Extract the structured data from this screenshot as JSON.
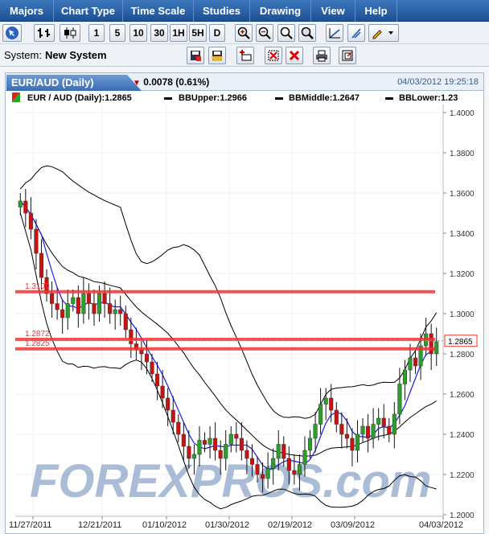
{
  "menu": [
    "Majors",
    "Chart Type",
    "Time Scale",
    "Studies",
    "Drawing",
    "View",
    "Help"
  ],
  "toolbar1": {
    "buttons": [
      "1",
      "5",
      "10",
      "30",
      "1H",
      "5H",
      "D"
    ]
  },
  "system": {
    "label": "System:",
    "value": "New System"
  },
  "chart_header": {
    "tab": "EUR/AUD (Daily)",
    "change": "0.0078 (0.61%)",
    "datetime": "04/03/2012 19:25:18"
  },
  "legend": {
    "main": "EUR / AUD (Daily):1.2865",
    "bbupper": "BBUpper:1.2966",
    "bbmiddle": "BBMiddle:1.2647",
    "bblower": "BBLower:1.23"
  },
  "watermark": "FOREXPROS.com",
  "colors": {
    "up": "#2aa02a",
    "down": "#cc1111",
    "hline": "#ee3333",
    "ma": "#1a1aee",
    "bb": "#000000",
    "menu": "#2a5ea8"
  },
  "chart_data": {
    "type": "candlestick",
    "symbol": "EUR/AUD",
    "current_price": "1.2865",
    "y_ticks": [
      "1.4000",
      "1.3800",
      "1.3600",
      "1.3400",
      "1.3200",
      "1.3000",
      "1.2800",
      "1.2600",
      "1.2400",
      "1.2200",
      "1.2000"
    ],
    "ylim": [
      1.2,
      1.4
    ],
    "x_ticks": [
      "11/27/2011",
      "12/21/2011",
      "01/10/2012",
      "01/30/2012",
      "02/19/2012",
      "03/09/2012",
      "04/03/2012"
    ],
    "hlines": [
      {
        "value": 1.3109,
        "label": "1.3109"
      },
      {
        "value": 1.2872,
        "label": "1.2872"
      },
      {
        "value": 1.2825,
        "label": "1.2825"
      }
    ],
    "approx_close": [
      1.356,
      1.35,
      1.342,
      1.33,
      1.318,
      1.31,
      1.305,
      1.302,
      1.298,
      1.305,
      1.308,
      1.3,
      1.31,
      1.305,
      1.3,
      1.31,
      1.305,
      1.3,
      1.302,
      1.3,
      1.292,
      1.285,
      1.282,
      1.28,
      1.276,
      1.27,
      1.264,
      1.258,
      1.252,
      1.246,
      1.24,
      1.234,
      1.228,
      1.23,
      1.237,
      1.235,
      1.238,
      1.232,
      1.228,
      1.235,
      1.24,
      1.238,
      1.232,
      1.228,
      1.225,
      1.22,
      1.218,
      1.223,
      1.228,
      1.235,
      1.228,
      1.222,
      1.22,
      1.225,
      1.232,
      1.238,
      1.245,
      1.255,
      1.258,
      1.252,
      1.245,
      1.24,
      1.238,
      1.232,
      1.24,
      1.244,
      1.238,
      1.245,
      1.248,
      1.244,
      1.24,
      1.25,
      1.265,
      1.272,
      1.278,
      1.274,
      1.284,
      1.29,
      1.28,
      1.286
    ]
  }
}
